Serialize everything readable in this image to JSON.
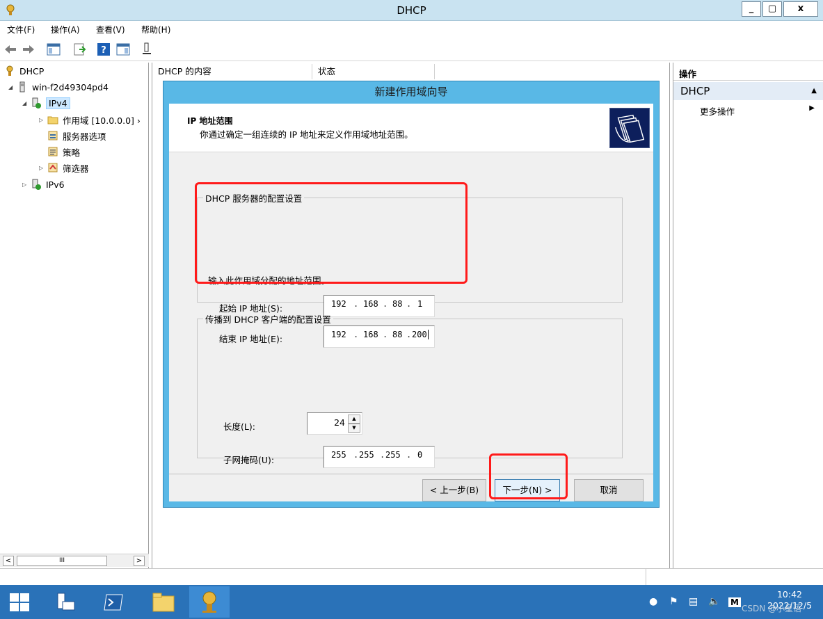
{
  "window": {
    "title": "DHCP",
    "minimize_label": "_",
    "maximize_label": "▢",
    "close_label": "x"
  },
  "menu": [
    "文件(F)",
    "操作(A)",
    "查看(V)",
    "帮助(H)"
  ],
  "tree": {
    "root": "DHCP",
    "server": "win-f2d49304pd4",
    "ipv4": "IPv4",
    "scope": "作用域 [10.0.0.0] ›",
    "server_options": "服务器选项",
    "policies": "策略",
    "filters": "筛选器",
    "ipv6": "IPv6"
  },
  "list": {
    "col1": "DHCP 的内容",
    "col2": "状态"
  },
  "actions": {
    "header": "操作",
    "section": "DHCP",
    "more": "更多操作"
  },
  "wizard": {
    "title": "新建作用域向导",
    "heading": "IP 地址范围",
    "subheading": "你通过确定一组连续的 IP 地址来定义作用域地址范围。",
    "group1": "DHCP 服务器的配置设置",
    "instruction": "输入此作用域分配的地址范围。",
    "start_label": "起始 IP 地址(S):",
    "start_ip": [
      "192",
      "168",
      "88",
      "1"
    ],
    "end_label": "结束 IP 地址(E):",
    "end_ip": [
      "192",
      "168",
      "88",
      "200"
    ],
    "group2": "传播到 DHCP 客户端的配置设置",
    "length_label": "长度(L):",
    "length_value": "24",
    "mask_label": "子网掩码(U):",
    "mask_ip": [
      "255",
      "255",
      "255",
      "0"
    ],
    "back_button": "< 上一步(B)",
    "next_button": "下一步(N) >",
    "cancel_button": "取消"
  },
  "taskbar": {
    "time": "10:42",
    "date": "2022/12/5",
    "watermark": "CSDN @小星语"
  }
}
